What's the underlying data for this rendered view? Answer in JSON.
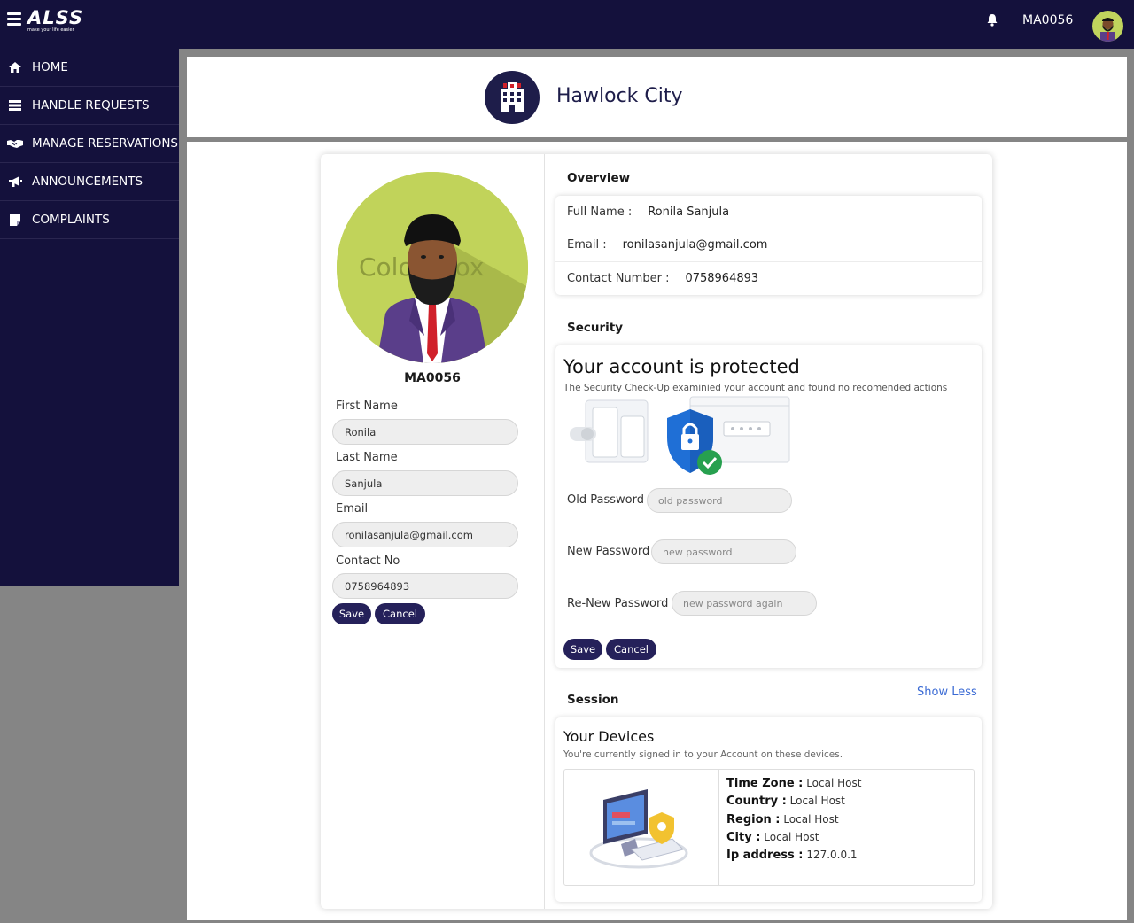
{
  "topbar": {
    "logo_text": "ALSS",
    "logo_tagline": "make your life easier",
    "user_code": "MA0056"
  },
  "sidebar": {
    "items": [
      {
        "label": "HOME",
        "icon": "home-icon"
      },
      {
        "label": "HANDLE REQUESTS",
        "icon": "list-icon"
      },
      {
        "label": "MANAGE RESERVATIONS",
        "icon": "handshake-icon"
      },
      {
        "label": "ANNOUNCEMENTS",
        "icon": "megaphone-icon"
      },
      {
        "label": "COMPLAINTS",
        "icon": "note-icon"
      }
    ]
  },
  "header": {
    "city_name": "Hawlock City"
  },
  "profile": {
    "avatar_watermark": "Colourbox",
    "code": "MA0056",
    "first_name_label": "First Name",
    "first_name": "Ronila",
    "last_name_label": "Last Name",
    "last_name": "Sanjula",
    "email_label": "Email",
    "email": "ronilasanjula@gmail.com",
    "contact_label": "Contact No",
    "contact": "0758964893",
    "save_label": "Save",
    "cancel_label": "Cancel"
  },
  "overview": {
    "title": "Overview",
    "full_name_key": "Full Name :",
    "full_name_val": "Ronila Sanjula",
    "email_key": "Email :",
    "email_val": "ronilasanjula@gmail.com",
    "contact_key": "Contact Number :",
    "contact_val": "0758964893"
  },
  "security": {
    "title": "Security",
    "heading": "Your account is protected",
    "subheading": "The Security Check-Up examinied your account and found no recomended actions",
    "old_label": "Old Password",
    "old_placeholder": "old password",
    "new_label": "New Password",
    "new_placeholder": "new password",
    "renew_label": "Re-New Password",
    "renew_placeholder": "new password again",
    "save_label": "Save",
    "cancel_label": "Cancel"
  },
  "session": {
    "title": "Session",
    "show_less": "Show Less",
    "heading": "Your Devices",
    "subheading": "You're currently signed in to your Account on these devices.",
    "timezone_key": "Time Zone :",
    "timezone_val": "Local Host",
    "country_key": "Country :",
    "country_val": "Local Host",
    "region_key": "Region :",
    "region_val": "Local Host",
    "city_key": "City :",
    "city_val": "Local Host",
    "ip_key": "Ip address :",
    "ip_val": "127.0.0.1"
  },
  "colors": {
    "navy": "#14113c",
    "button": "#25215a",
    "link": "#3a6ad4",
    "shield": "#1f6fd6",
    "check": "#27a04f",
    "avatar_bg": "#c1d35a"
  }
}
